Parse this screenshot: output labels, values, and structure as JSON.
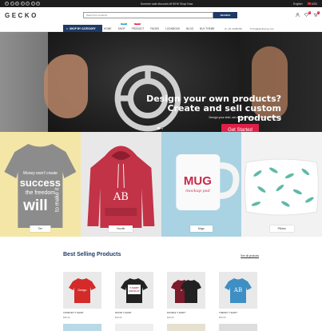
{
  "topbar": {
    "social_icons": [
      "facebook-icon",
      "twitter-icon",
      "google-plus-icon",
      "pinterest-icon",
      "instagram-icon",
      "youtube-icon",
      "vimeo-icon"
    ],
    "promo": "Summer sale discount off 50%! Shop Now",
    "language": "English",
    "currency": "USD"
  },
  "header": {
    "logo": "GECKO",
    "search_placeholder": "Search for products",
    "search_button": "SEARCH",
    "wishlist_count": "0",
    "cart_count": "0"
  },
  "nav": {
    "shop_by_category": "SHOP BY CATEGORY",
    "items": [
      {
        "label": "Home"
      },
      {
        "label": "Shop",
        "tag": "NEW",
        "tag_color": "#2a9fd6"
      },
      {
        "label": "Product",
        "tag": "SALE",
        "tag_color": "#e01f47"
      },
      {
        "label": "Pages"
      },
      {
        "label": "Lookbook"
      },
      {
        "label": "Blog"
      },
      {
        "label": "Buy Theme"
      }
    ],
    "phone": "+01 23456789",
    "email": "info@jamthemes.com"
  },
  "hero": {
    "headline_1": "Design your own products?",
    "headline_2": "Create and sell custom products",
    "subtext": "Design your shirt, set a price, add a goal and start selling",
    "cta": "Get Started"
  },
  "categories": [
    {
      "label": "Tee",
      "bg": "#f4e6a6"
    },
    {
      "label": "Hoodie",
      "bg": "#e8e8e8"
    },
    {
      "label": "Mugs",
      "bg": "#a9d3e3"
    },
    {
      "label": "Pillows",
      "bg": "#f2f2f2"
    }
  ],
  "tee_text": {
    "l1": "Money won't create",
    "l2": "success",
    "l3": "the freedom",
    "l4": "to make it",
    "l5": "will"
  },
  "mug_text": {
    "top": "MUG",
    "sub": "mockup psd"
  },
  "best_selling": {
    "title": "Best Selling Products",
    "view_all": "See all products",
    "products": [
      {
        "name": "Comfort T-Shirt",
        "price": "$35.00"
      },
      {
        "name": "White T-Shirt",
        "price": "$29.00"
      },
      {
        "name": "Double T-Shirt",
        "price": "$39.00"
      },
      {
        "name": "Trendy T-Shirt",
        "price": "$35.00"
      }
    ]
  },
  "colors": {
    "navy": "#1e3a66",
    "accent": "#e01f47"
  }
}
